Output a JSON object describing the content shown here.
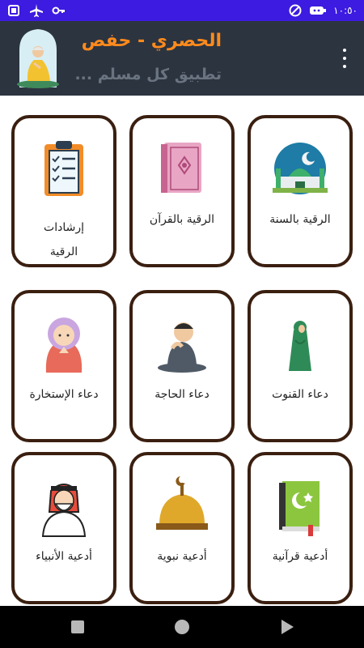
{
  "status_bar": {
    "time": "١٠:٥٠",
    "icons": [
      "notification-icon",
      "airplane-icon",
      "key-icon",
      "data-saver-icon",
      "battery-icon"
    ],
    "color": "#3d1be0"
  },
  "header": {
    "title": "الحصري - حفص",
    "subtitle": "تطبيق كل مسلم ...",
    "background": "#2c3440",
    "title_color": "#ff8a1c"
  },
  "cards": [
    {
      "label": "الرقية بالسنة",
      "icon": "mosque-icon"
    },
    {
      "label": "الرقية بالقرآن",
      "icon": "quran-book-icon"
    },
    {
      "label": "إرشادات الرقية",
      "icon": "clipboard-checklist-icon"
    },
    {
      "label": "دعاء القنوت",
      "icon": "praying-woman-icon"
    },
    {
      "label": "دعاء الحاجة",
      "icon": "praying-boy-icon"
    },
    {
      "label": "دعاء الإستخارة",
      "icon": "praying-girl-icon"
    },
    {
      "label": "أدعية قرآنية",
      "icon": "green-quran-icon"
    },
    {
      "label": "أدعية نبوية",
      "icon": "dome-crescent-icon"
    },
    {
      "label": "أدعية الأنبياء",
      "icon": "prophet-man-icon"
    }
  ],
  "nav_bar": {
    "buttons": [
      "recent-apps-icon",
      "home-icon",
      "back-icon"
    ]
  }
}
